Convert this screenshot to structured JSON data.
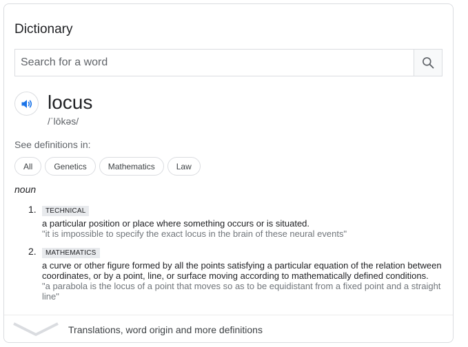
{
  "card": {
    "title": "Dictionary"
  },
  "search": {
    "placeholder": "Search for a word"
  },
  "entry": {
    "word": "locus",
    "phonetic": "/ˈlōkəs/"
  },
  "see_definitions": {
    "label": "See definitions in:",
    "chips": [
      "All",
      "Genetics",
      "Mathematics",
      "Law"
    ]
  },
  "part_of_speech": "noun",
  "definitions": [
    {
      "number": "1.",
      "label": "TECHNICAL",
      "text": "a particular position or place where something occurs or is situated.",
      "example": "\"it is impossible to specify the exact locus in the brain of these neural events\""
    },
    {
      "number": "2.",
      "label": "MATHEMATICS",
      "text": "a curve or other figure formed by all the points satisfying a particular equation of the relation between coordinates, or by a point, line, or surface moving according to mathematically defined conditions.",
      "example": "\"a parabola is the locus of a point that moves so as to be equidistant from a fixed point and a straight line\""
    }
  ],
  "footer": {
    "text": "Translations, word origin and more definitions",
    "icon": "chevron-down-icon"
  },
  "colors": {
    "accent_blue": "#1a73e8",
    "border": "#dadce0",
    "label_bg": "#e8eaed"
  }
}
